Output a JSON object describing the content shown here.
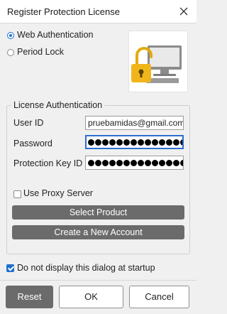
{
  "window": {
    "title": "Register Protection License",
    "close_icon": "close-icon"
  },
  "auth_mode": {
    "options": [
      {
        "label": "Web Authentication",
        "selected": true
      },
      {
        "label": "Period Lock",
        "selected": false
      }
    ]
  },
  "illustration": {
    "icon": "computer-with-padlock-icon",
    "accent": "#f1b51c"
  },
  "license_group": {
    "legend": "License Authentication",
    "user_id": {
      "label": "User ID",
      "value": "pruebamidas@gmail.com"
    },
    "password": {
      "label": "Password",
      "masked_count": 14
    },
    "protection_key_id": {
      "label": "Protection Key ID",
      "masked_count": 14
    },
    "use_proxy": {
      "label": "Use Proxy Server",
      "checked": false
    },
    "select_product_label": "Select Product",
    "create_account_label": "Create a New Account"
  },
  "startup_option": {
    "label": "Do not display this dialog at startup",
    "checked": true
  },
  "footer": {
    "reset_label": "Reset",
    "ok_label": "OK",
    "cancel_label": "Cancel"
  },
  "colors": {
    "accent": "#1e6fd0",
    "dark_button": "#6b6b6b",
    "background": "#f0f0f0"
  }
}
